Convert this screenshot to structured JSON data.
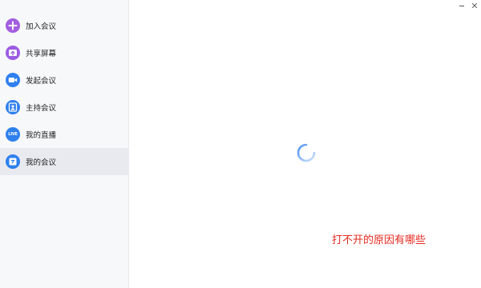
{
  "window_controls": {
    "minimize_icon": "minimize-icon",
    "close_icon": "close-icon"
  },
  "sidebar": {
    "items": [
      {
        "label": "加入会议",
        "icon": "plus-icon",
        "color": "#a25ee0",
        "active": false
      },
      {
        "label": "共享屏幕",
        "icon": "share-screen-icon",
        "color": "#9b5be4",
        "active": false
      },
      {
        "label": "发起会议",
        "icon": "video-camera-icon",
        "color": "#2f80ed",
        "active": false
      },
      {
        "label": "主持会议",
        "icon": "host-icon",
        "color": "#2f80ed",
        "active": false
      },
      {
        "label": "我的直播",
        "icon": "live-icon",
        "color": "#2f80ed",
        "active": false,
        "badge": "LIVE"
      },
      {
        "label": "我的会议",
        "icon": "my-meetings-icon",
        "color": "#2f80ed",
        "active": true
      }
    ]
  },
  "main": {
    "loading_icon": "loading-spinner-icon",
    "spinner_color": "#4a8ff0"
  },
  "overlay": {
    "text": "打不开的原因有哪些",
    "color": "#e8281e"
  }
}
